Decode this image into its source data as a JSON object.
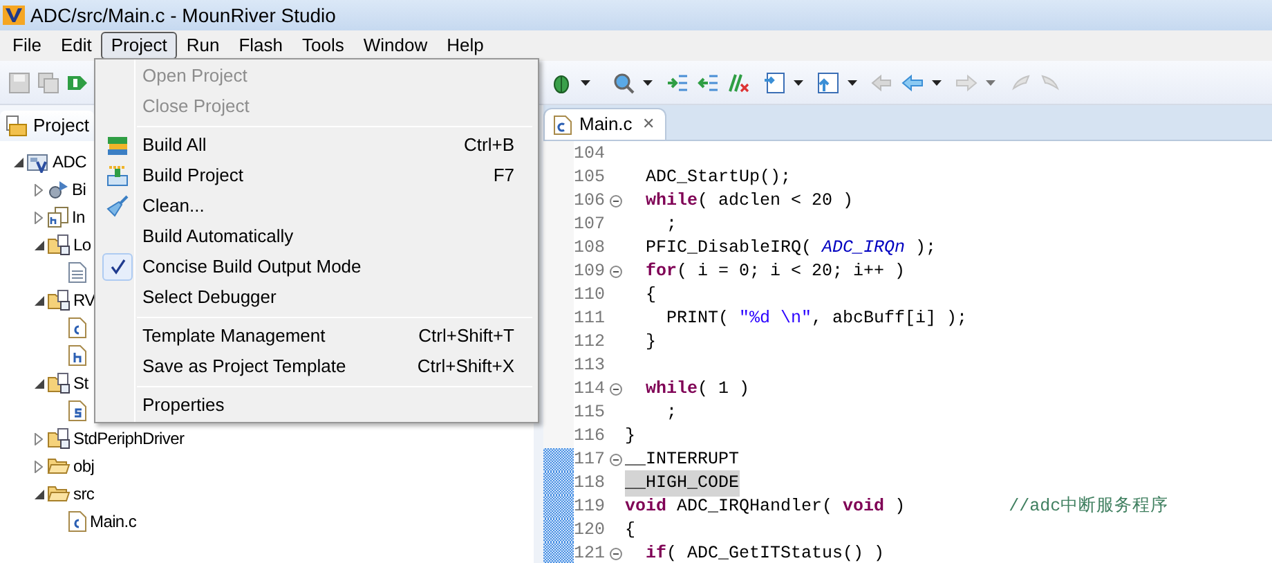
{
  "window": {
    "title": "ADC/src/Main.c - MounRiver Studio"
  },
  "menubar": [
    {
      "label": "File",
      "selected": false
    },
    {
      "label": "Edit",
      "selected": false
    },
    {
      "label": "Project",
      "selected": true
    },
    {
      "label": "Run",
      "selected": false
    },
    {
      "label": "Flash",
      "selected": false
    },
    {
      "label": "Tools",
      "selected": false
    },
    {
      "label": "Window",
      "selected": false
    },
    {
      "label": "Help",
      "selected": false
    }
  ],
  "explorer": {
    "tab": "Project",
    "tree": [
      {
        "label": "ADC",
        "kind": "project",
        "expanded": true,
        "children": [
          {
            "label": "Bi",
            "kind": "binaries",
            "expanded": false
          },
          {
            "label": "In",
            "kind": "includes",
            "expanded": false
          },
          {
            "label": "Lo",
            "kind": "source-folder",
            "expanded": true,
            "children": [
              {
                "kind": "file-text"
              }
            ]
          },
          {
            "label": "RV",
            "kind": "source-folder",
            "expanded": true,
            "children": [
              {
                "kind": "file-c"
              },
              {
                "kind": "file-h"
              }
            ]
          },
          {
            "label": "St",
            "kind": "source-folder",
            "expanded": true,
            "children": [
              {
                "kind": "file-s"
              }
            ]
          },
          {
            "label": "StdPeriphDriver",
            "kind": "source-folder",
            "expanded": false
          },
          {
            "label": "obj",
            "kind": "folder",
            "expanded": false
          },
          {
            "label": "src",
            "kind": "folder",
            "expanded": true,
            "children": [
              {
                "label": "Main.c",
                "kind": "file-c"
              }
            ]
          }
        ]
      }
    ]
  },
  "project_menu": [
    {
      "kind": "item",
      "label": "Open Project",
      "disabled": true,
      "checked": false
    },
    {
      "kind": "item",
      "label": "Close Project",
      "disabled": true,
      "checked": false
    },
    {
      "kind": "separator"
    },
    {
      "kind": "item",
      "label": "Build All",
      "shortcut": "Ctrl+B",
      "disabled": false,
      "checked": false
    },
    {
      "kind": "item",
      "label": "Build Project",
      "shortcut": "F7",
      "disabled": false,
      "checked": false
    },
    {
      "kind": "item",
      "label": "Clean...",
      "disabled": false,
      "checked": false
    },
    {
      "kind": "item",
      "label": "Build Automatically",
      "disabled": false,
      "checked": false
    },
    {
      "kind": "item",
      "label": "Concise Build Output Mode",
      "disabled": false,
      "checked": true
    },
    {
      "kind": "item",
      "label": "Select Debugger",
      "disabled": false,
      "checked": false
    },
    {
      "kind": "separator"
    },
    {
      "kind": "item",
      "label": "Template Management",
      "shortcut": "Ctrl+Shift+T",
      "disabled": false,
      "checked": false
    },
    {
      "kind": "item",
      "label": "Save as Project Template",
      "shortcut": "Ctrl+Shift+X",
      "disabled": false,
      "checked": false
    },
    {
      "kind": "separator"
    },
    {
      "kind": "item",
      "label": "Properties",
      "disabled": false,
      "checked": false
    }
  ],
  "editor": {
    "tab": {
      "label": "Main.c",
      "close": "✕"
    },
    "lines": [
      {
        "number": "104",
        "foldable": false,
        "highlighted": false,
        "in_range": false,
        "indented": false
      },
      {
        "number": "105",
        "foldable": false,
        "highlighted": false,
        "in_range": false,
        "indented": false,
        "segments": [
          {
            "kind": "plain",
            "text": "  ADC_StartUp();"
          }
        ]
      },
      {
        "number": "106",
        "foldable": true,
        "highlighted": false,
        "in_range": false,
        "indented": true,
        "segments": [
          {
            "kind": "keyword",
            "text": "while"
          },
          {
            "kind": "plain",
            "text": "( adclen < 20 )"
          }
        ]
      },
      {
        "number": "107",
        "foldable": false,
        "highlighted": false,
        "in_range": false,
        "indented": false,
        "segments": [
          {
            "kind": "plain",
            "text": "    ;"
          }
        ]
      },
      {
        "number": "108",
        "foldable": false,
        "highlighted": false,
        "in_range": false,
        "indented": false,
        "segments": [
          {
            "kind": "plain",
            "text": "  PFIC_DisableIRQ( "
          },
          {
            "kind": "macro",
            "text": "ADC_IRQn"
          },
          {
            "kind": "plain",
            "text": " );"
          }
        ]
      },
      {
        "number": "109",
        "foldable": true,
        "highlighted": false,
        "in_range": false,
        "indented": true,
        "segments": [
          {
            "kind": "keyword",
            "text": "for"
          },
          {
            "kind": "plain",
            "text": "( i = 0; i < 20; i++ )"
          }
        ]
      },
      {
        "number": "110",
        "foldable": false,
        "highlighted": false,
        "in_range": false,
        "indented": false,
        "segments": [
          {
            "kind": "plain",
            "text": "  {"
          }
        ]
      },
      {
        "number": "111",
        "foldable": false,
        "highlighted": false,
        "in_range": false,
        "indented": false,
        "segments": [
          {
            "kind": "plain",
            "text": "    PRINT( "
          },
          {
            "kind": "string",
            "text": "\"%d \\n\""
          },
          {
            "kind": "plain",
            "text": ", abcBuff[i] );"
          }
        ]
      },
      {
        "number": "112",
        "foldable": false,
        "highlighted": false,
        "in_range": false,
        "indented": false,
        "segments": [
          {
            "kind": "plain",
            "text": "  }"
          }
        ]
      },
      {
        "number": "113",
        "foldable": false,
        "highlighted": false,
        "in_range": false,
        "indented": false
      },
      {
        "number": "114",
        "foldable": true,
        "highlighted": false,
        "in_range": false,
        "indented": true,
        "segments": [
          {
            "kind": "keyword",
            "text": "while"
          },
          {
            "kind": "plain",
            "text": "( 1 )"
          }
        ]
      },
      {
        "number": "115",
        "foldable": false,
        "highlighted": false,
        "in_range": false,
        "indented": false,
        "segments": [
          {
            "kind": "plain",
            "text": "    ;"
          }
        ]
      },
      {
        "number": "116",
        "foldable": false,
        "highlighted": false,
        "in_range": false,
        "indented": false,
        "segments": [
          {
            "kind": "plain",
            "text": "}"
          }
        ]
      },
      {
        "number": "117",
        "foldable": true,
        "highlighted": false,
        "in_range": true,
        "indented": false,
        "segments": [
          {
            "kind": "plain",
            "text": "__INTERRUPT"
          }
        ]
      },
      {
        "number": "118",
        "foldable": false,
        "highlighted": true,
        "in_range": true,
        "indented": false,
        "segments": [
          {
            "kind": "plain",
            "text": "__HIGH_CODE"
          }
        ]
      },
      {
        "number": "119",
        "foldable": false,
        "highlighted": false,
        "in_range": true,
        "indented": false,
        "segments": [
          {
            "kind": "keyword",
            "text": "void"
          },
          {
            "kind": "plain",
            "text": " ADC_IRQHandler( "
          },
          {
            "kind": "keyword",
            "text": "void"
          },
          {
            "kind": "plain",
            "text": " )          "
          },
          {
            "kind": "comment",
            "text": "//adc中断服务程序"
          }
        ]
      },
      {
        "number": "120",
        "foldable": false,
        "highlighted": false,
        "in_range": true,
        "indented": false,
        "segments": [
          {
            "kind": "plain",
            "text": "{"
          }
        ]
      },
      {
        "number": "121",
        "foldable": true,
        "highlighted": false,
        "in_range": true,
        "indented": true,
        "segments": [
          {
            "kind": "keyword",
            "text": "if"
          },
          {
            "kind": "plain",
            "text": "( ADC_GetITStatus() )"
          }
        ]
      }
    ]
  }
}
